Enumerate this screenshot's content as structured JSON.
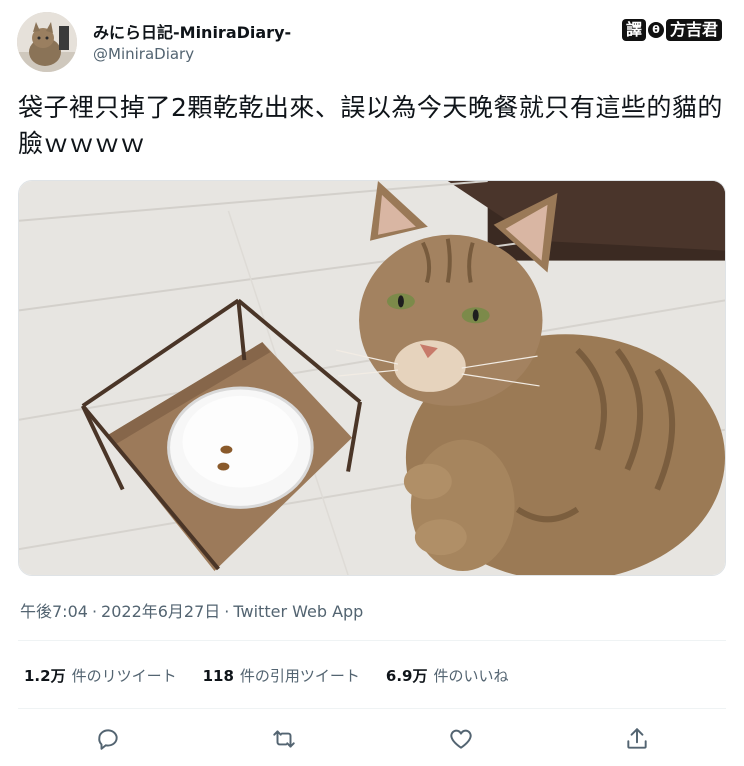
{
  "author": {
    "display_name": "みにら日記-MiniraDiary-",
    "handle": "@MiniraDiary"
  },
  "watermark": {
    "part1": "譯",
    "part2": "θ",
    "part3": "方吉君"
  },
  "tweet": {
    "text": "袋子裡只掉了2顆乾乾出來、誤以為今天晚餐就只有這些的貓的臉ｗｗｗｗ"
  },
  "meta": {
    "time": "午後7:04",
    "separator": "·",
    "date": "2022年6月27日",
    "source": "Twitter Web App"
  },
  "stats": [
    {
      "value": "1.2万",
      "label": "件のリツイート"
    },
    {
      "value": "118",
      "label": "件の引用ツイート"
    },
    {
      "value": "6.9万",
      "label": "件のいいね"
    }
  ],
  "actions": {
    "reply_icon": "reply-icon",
    "retweet_icon": "retweet-icon",
    "like_icon": "heart-icon",
    "share_icon": "share-icon"
  },
  "colors": {
    "secondary_text": "#536471",
    "primary_text": "#0f1419",
    "divider": "#eff3f4"
  }
}
